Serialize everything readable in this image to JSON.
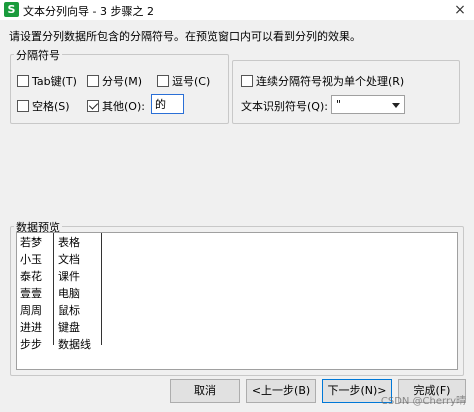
{
  "window": {
    "title": "文本分列向导 - 3 步骤之 2",
    "app_icon_letter": "S",
    "close_glyph": "×"
  },
  "instruction": "请设置分列数据所包含的分隔符号。在预览窗口内可以看到分列的效果。",
  "delimiters": {
    "group_title": "分隔符号",
    "tab": {
      "label": "Tab键(T)",
      "checked": false
    },
    "semicolon": {
      "label": "分号(M)",
      "checked": false
    },
    "comma": {
      "label": "逗号(C)",
      "checked": false
    },
    "space": {
      "label": "空格(S)",
      "checked": false
    },
    "other": {
      "label": "其他(O):",
      "checked": true,
      "value": "的"
    }
  },
  "options": {
    "consecutive": {
      "label": "连续分隔符号视为单个处理(R)",
      "checked": false
    },
    "text_qualifier_label": "文本识别符号(Q):",
    "text_qualifier_value": "\""
  },
  "preview": {
    "title": "数据预览",
    "columns": [
      [
        "若梦",
        "小玉",
        "泰花",
        "壹壹",
        "周周",
        "进进",
        "步步"
      ],
      [
        "表格",
        "文档",
        "课件",
        "电脑",
        "鼠标",
        "键盘",
        "数据线"
      ]
    ]
  },
  "buttons": {
    "cancel": "取消",
    "back": "<上一步(B)",
    "next": "下一步(N)>",
    "finish": "完成(F)"
  },
  "watermark": "CSDN @Cherry晴"
}
